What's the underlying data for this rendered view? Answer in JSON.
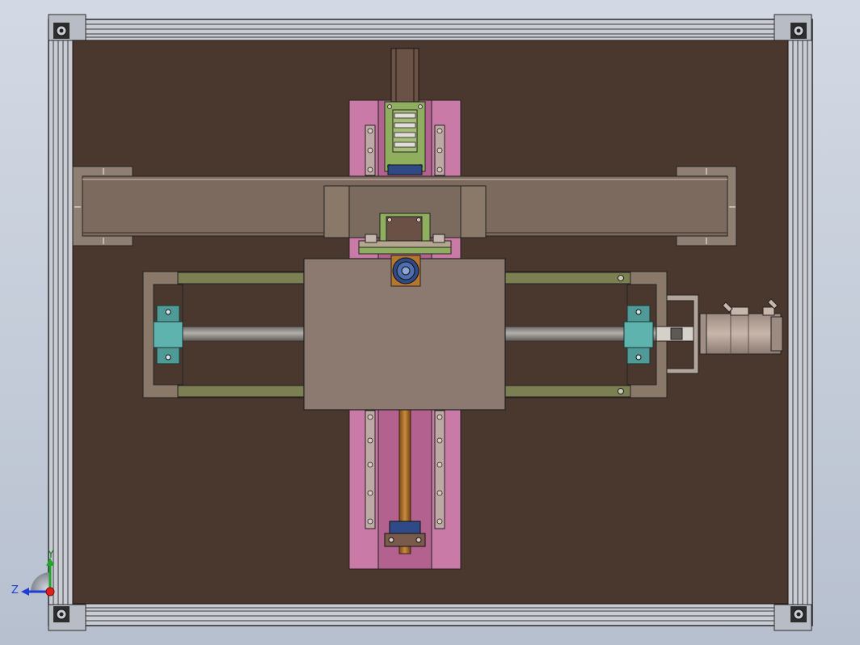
{
  "view": {
    "background_top": "#d3d9e4",
    "background_bottom": "#b7c0cf"
  },
  "colors": {
    "base_plate": "#4a372e",
    "frame_profile": "#c9ccd4",
    "frame_edge": "#2b2b2b",
    "y_stage_plate": "#c97aa6",
    "y_rail": "#bfa9a5",
    "x_stage_beam": "#7d6a5e",
    "gantry_bridge": "#8a7869",
    "carriage_plate": "#8c7a70",
    "guide_rail": "#7b7f52",
    "ball_screw": "#8e8a86",
    "bearing_block": "#4f9a96",
    "servo_motor": "#b39f95",
    "coupling_green": "#8fae5e",
    "lead_screw": "#b5762e",
    "nut_blue": "#2f4a86"
  },
  "triad": {
    "y_label": "Y",
    "z_label": "Z",
    "x_axis_color": "#e0201c",
    "y_axis_color": "#22a52a",
    "z_axis_color": "#1f3fd1"
  }
}
